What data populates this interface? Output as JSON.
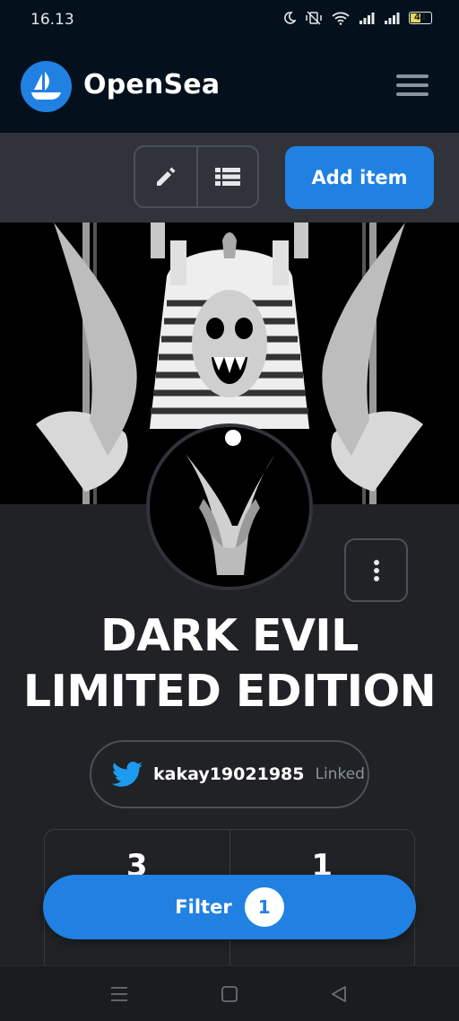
{
  "status_bar": {
    "time": "16.13",
    "battery": "41",
    "icons": [
      "moon-icon",
      "vibrate-off-icon",
      "wifi-icon",
      "signal-icon",
      "signal-icon",
      "battery-icon"
    ]
  },
  "header": {
    "brand": "OpenSea",
    "logo_icon": "sailboat-icon",
    "menu_icon": "hamburger-icon"
  },
  "toolbar": {
    "edit_icon": "pencil-icon",
    "list_icon": "list-icon",
    "add_item_label": "Add item"
  },
  "collection": {
    "title_line1": "DARK EVIL",
    "title_line2": "LIMITED EDITION",
    "more_icon": "more-vertical-icon"
  },
  "twitter": {
    "icon": "twitter-icon",
    "handle": "kakay19021985",
    "status": "Linked"
  },
  "stats": [
    {
      "value": "3"
    },
    {
      "value": "1"
    }
  ],
  "filter": {
    "label": "Filter",
    "count": "1"
  },
  "nav_bar": {
    "items": [
      "menu-nav-icon",
      "home-nav-icon",
      "back-nav-icon"
    ]
  },
  "colors": {
    "accent": "#2081e2",
    "header_bg": "#04111d",
    "page_bg": "#202225",
    "toolbar_bg": "#303339"
  }
}
